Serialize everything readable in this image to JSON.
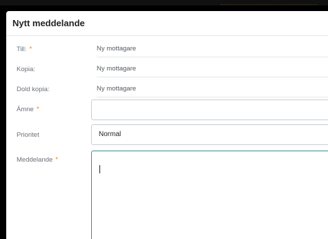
{
  "dialog": {
    "title": "Nytt meddelande"
  },
  "fields": {
    "to": {
      "label": "Till:",
      "required_mark": "*",
      "placeholder": "Ny mottagare"
    },
    "cc": {
      "label": "Kopia:",
      "placeholder": "Ny mottagare"
    },
    "bcc": {
      "label": "Dold kopia:",
      "placeholder": "Ny mottagare"
    },
    "subject": {
      "label": "Ämne",
      "required_mark": "*",
      "value": ""
    },
    "priority": {
      "label": "Prioritet",
      "value": "Normal"
    },
    "message": {
      "label": "Meddelande",
      "required_mark": "*",
      "value": ""
    }
  },
  "colors": {
    "required": "#f08a24",
    "focus_border": "#3f8a9a",
    "border": "#c9cdd2"
  }
}
